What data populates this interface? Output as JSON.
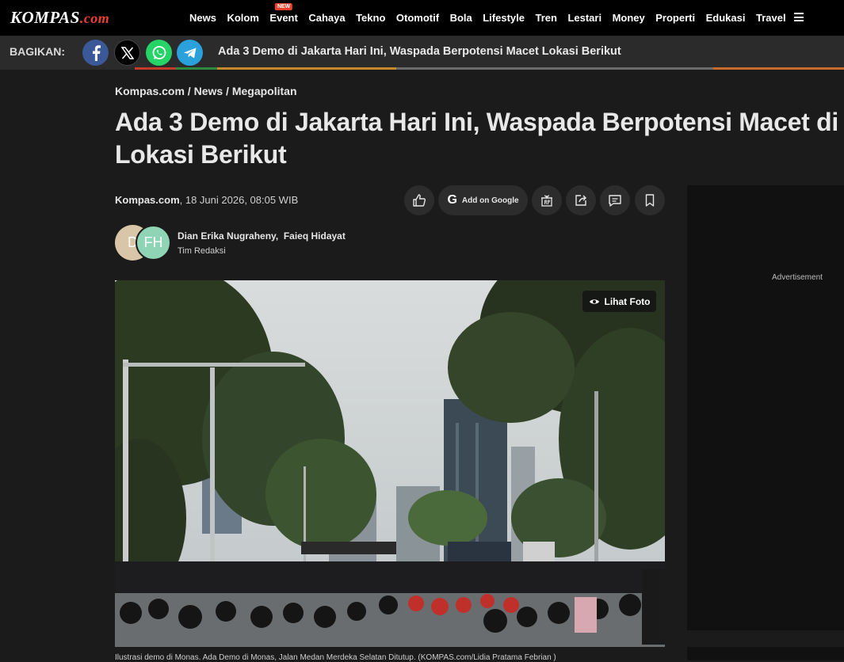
{
  "brand": {
    "logo_main": "KOMPAS",
    "logo_suffix": ".com"
  },
  "nav": {
    "items": [
      {
        "label": "News"
      },
      {
        "label": "Kolom"
      },
      {
        "label": "Event",
        "badge": "NEW"
      },
      {
        "label": "Cahaya"
      },
      {
        "label": "Tekno"
      },
      {
        "label": "Otomotif"
      },
      {
        "label": "Bola"
      },
      {
        "label": "Lifestyle"
      },
      {
        "label": "Tren"
      },
      {
        "label": "Lestari"
      },
      {
        "label": "Money"
      },
      {
        "label": "Properti"
      },
      {
        "label": "Edukasi"
      },
      {
        "label": "Travel"
      }
    ],
    "menu_icon": "hamburger-icon"
  },
  "share": {
    "label": "BAGIKAN:",
    "buttons": [
      "facebook-icon",
      "x-icon",
      "whatsapp-icon",
      "telegram-icon"
    ],
    "headline": "Ada 3 Demo di Jakarta Hari Ini, Waspada Berpotensi Macet Lokasi Berikut"
  },
  "article": {
    "breadcrumb": [
      "Kompas.com",
      "News",
      "Megapolitan"
    ],
    "breadcrumb_sep": " / ",
    "title": "Ada 3 Demo di Jakarta Hari Ini, Waspada Berpotensi Macet di Lokasi Berikut",
    "source": "Kompas.com",
    "date": ", 18 Juni 2026, 08:05 WIB",
    "google_button": "Add on Google",
    "google_letter": "G",
    "author_initials": [
      "D",
      "FH"
    ],
    "author_1": "Dian Erika Nugraheny,",
    "author_2": "Faieq Hidayat",
    "team": "Tim Redaksi",
    "photo_button": "Lihat Foto",
    "caption": "Ilustrasi demo di Monas. Ada Demo di Monas, Jalan Medan Merdeka Selatan Ditutup. (KOMPAS.com/Lidia Pratama Febrian )"
  },
  "ad": {
    "label": "Advertisement"
  },
  "colors": {
    "accent": "#e8422e",
    "background": "#1b1b1b",
    "nav": "#000000"
  }
}
